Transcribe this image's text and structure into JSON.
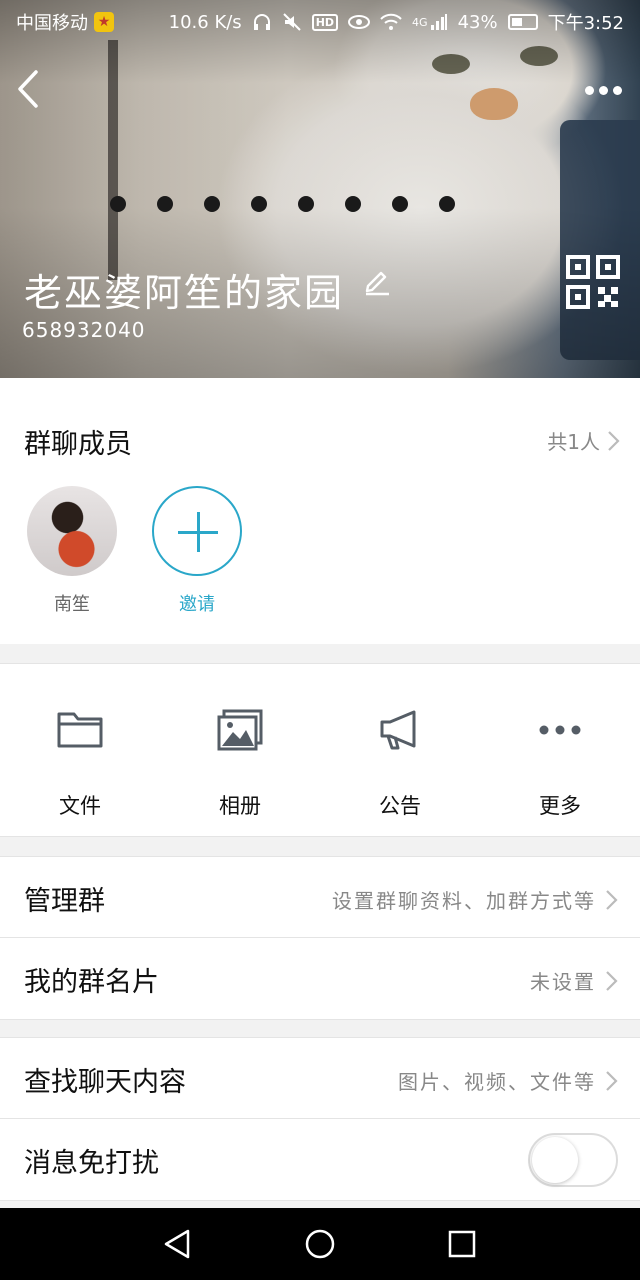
{
  "status_bar": {
    "carrier": "中国移动",
    "speed": "10.6 K/s",
    "hd": "HD",
    "network": "4G",
    "battery": "43%",
    "time": "下午3:52"
  },
  "header": {
    "group_name": "老巫婆阿笙的家园",
    "group_id": "658932040",
    "icons": [
      "back-icon",
      "more-icon",
      "edit-icon",
      "qr-code-icon"
    ]
  },
  "members": {
    "title": "群聊成员",
    "count": "共1人",
    "list": [
      {
        "name": "南笙"
      }
    ],
    "invite_label": "邀请"
  },
  "functions": [
    {
      "label": "文件",
      "icon": "folder-icon"
    },
    {
      "label": "相册",
      "icon": "album-icon"
    },
    {
      "label": "公告",
      "icon": "megaphone-icon"
    },
    {
      "label": "更多",
      "icon": "more-dots-icon"
    }
  ],
  "settings": {
    "manage": {
      "label": "管理群",
      "value": "设置群聊资料、加群方式等"
    },
    "my_card": {
      "label": "我的群名片",
      "value": "未设置"
    },
    "search": {
      "label": "查找聊天内容",
      "value": "图片、视频、文件等"
    },
    "dnd": {
      "label": "消息免打扰",
      "enabled": false
    }
  },
  "colors": {
    "accent": "#2aa7c9",
    "secondary_text": "#888888"
  }
}
